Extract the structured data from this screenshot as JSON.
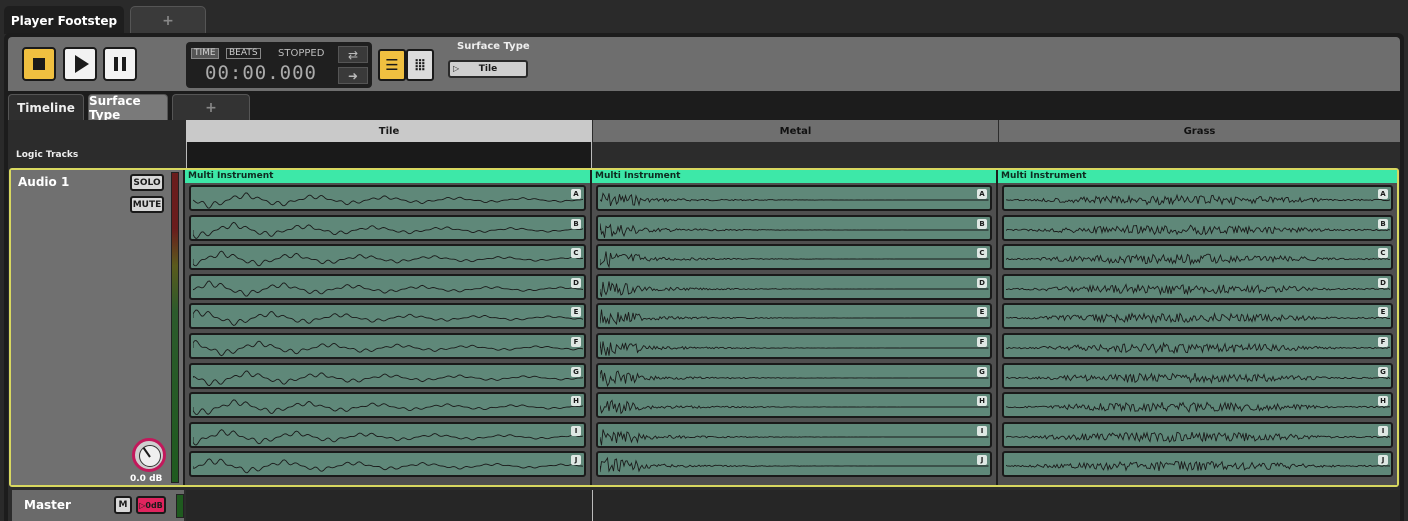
{
  "document_tabs": [
    {
      "label": "Player Footstep"
    },
    {
      "label": "+"
    }
  ],
  "transport": {
    "mode_time": "TIME",
    "mode_beats": "BEATS",
    "status": "STOPPED",
    "clock": "00:00.000",
    "loop_icon": "loop-icon",
    "follow_icon": "arrow-right-icon"
  },
  "parameter": {
    "label": "Surface Type",
    "value": "Tile"
  },
  "editor_tabs": [
    {
      "label": "Timeline"
    },
    {
      "label": "Surface Type"
    },
    {
      "label": "+"
    }
  ],
  "columns": [
    {
      "label": "Tile"
    },
    {
      "label": "Metal"
    },
    {
      "label": "Grass"
    }
  ],
  "logic_tracks_label": "Logic Tracks",
  "track": {
    "name": "Audio 1",
    "solo_label": "SOLO",
    "mute_label": "MUTE",
    "gain": "0.0 dB"
  },
  "instruments": [
    {
      "title": "Multi Instrument"
    },
    {
      "title": "Multi Instrument"
    },
    {
      "title": "Multi Instrument"
    }
  ],
  "clip_letters": [
    "A",
    "B",
    "C",
    "D",
    "E",
    "F",
    "G",
    "H",
    "I",
    "J"
  ],
  "master": {
    "name": "Master",
    "mono_label": "M",
    "output_label": "▷0dB"
  },
  "colors": {
    "accent": "#f0c040",
    "instrument": "#3de8a8",
    "clip": "#5f8879",
    "track_border": "#d8d860",
    "output": "#e0245e"
  }
}
